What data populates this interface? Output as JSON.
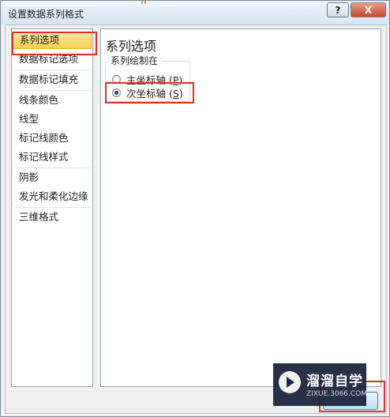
{
  "window": {
    "title": "设置数据系列格式",
    "help_label": "?",
    "close_label": "X"
  },
  "nav": {
    "items": [
      {
        "label": "系列选项",
        "selected": true
      },
      {
        "label": "数据标记选项"
      },
      {
        "label": "数据标记填充"
      },
      {
        "label": "线条颜色"
      },
      {
        "label": "线型"
      },
      {
        "label": "标记线颜色"
      },
      {
        "label": "标记线样式"
      },
      {
        "label": "阴影"
      },
      {
        "label": "发光和柔化边缘"
      },
      {
        "label": "三维格式"
      }
    ]
  },
  "content": {
    "heading": "系列选项",
    "group_label": "系列绘制在",
    "options": [
      {
        "label": "主坐标轴",
        "mnemonic": "P",
        "checked": false
      },
      {
        "label": "次坐标轴",
        "mnemonic": "S",
        "checked": true
      }
    ]
  },
  "watermark": {
    "name": "溜溜自学",
    "url": "ZIXUE.3066.COM"
  },
  "colors": {
    "highlight": "#d6322c",
    "selected_item": "#f8cf55",
    "radio_dot": "#1d3e86"
  }
}
